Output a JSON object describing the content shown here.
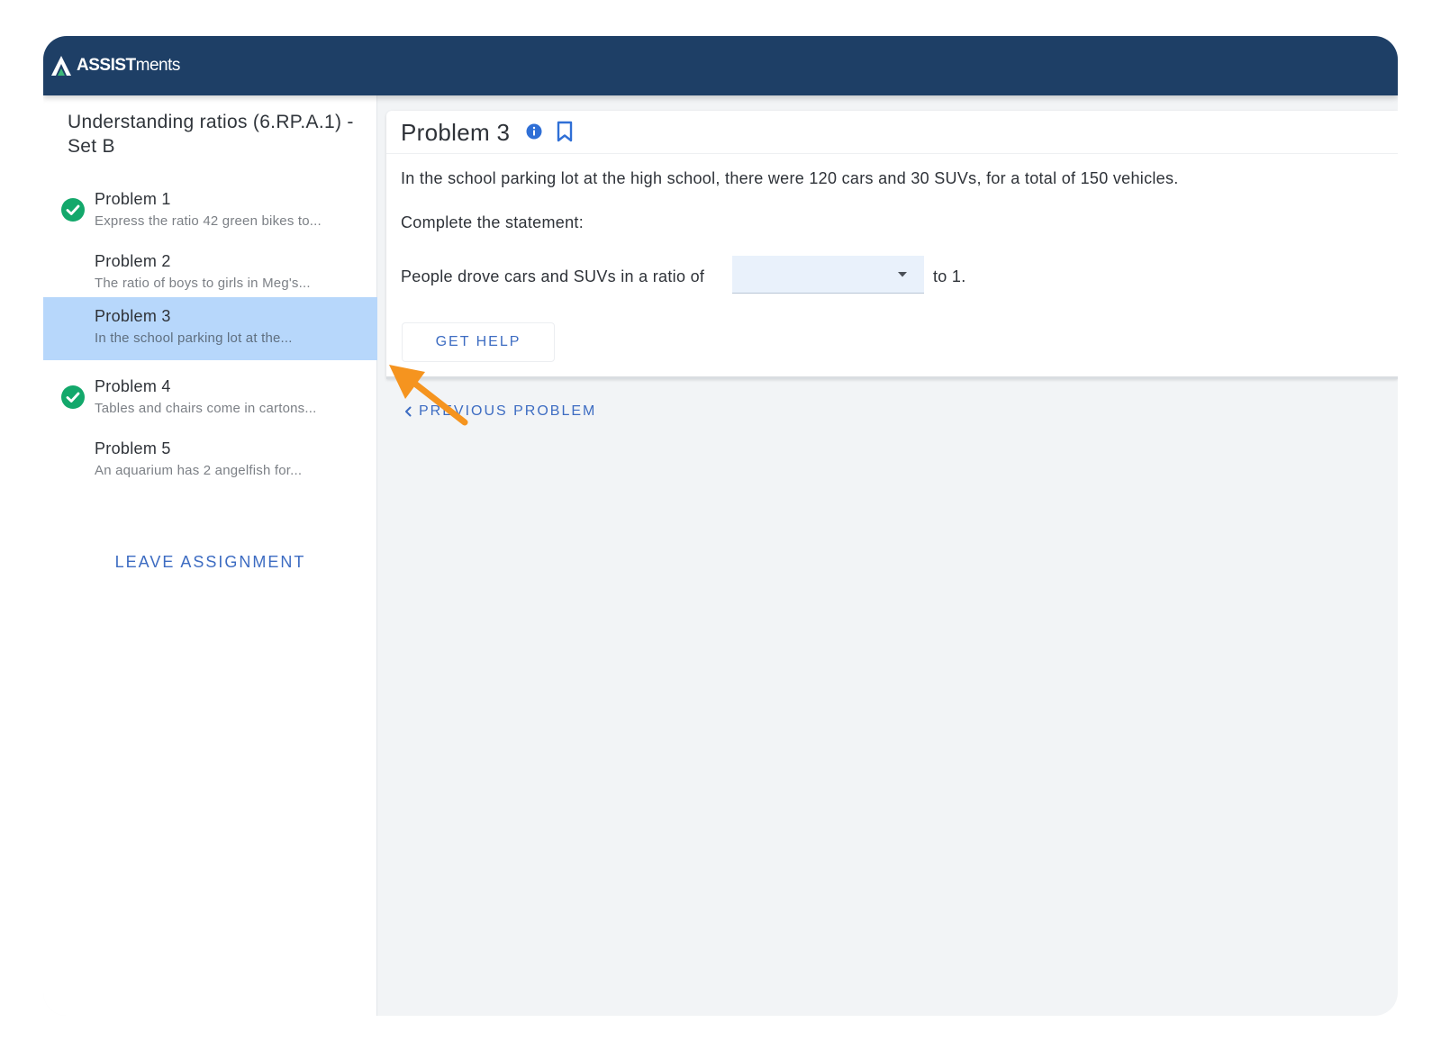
{
  "app": {
    "logo_bold": "ASSIST",
    "logo_light": "ments"
  },
  "sidebar": {
    "assignment_title": "Understanding ratios (6.RP.A.1) - Set B",
    "problems": [
      {
        "name": "Problem 1",
        "preview": "Express the ratio 42 green bikes to...",
        "completed": true,
        "selected": false
      },
      {
        "name": "Problem 2",
        "preview": "The ratio of boys to girls in Meg's...",
        "completed": false,
        "selected": false
      },
      {
        "name": "Problem 3",
        "preview": "In the school parking lot at the...",
        "completed": false,
        "selected": true
      },
      {
        "name": "Problem 4",
        "preview": "Tables and chairs come in cartons...",
        "completed": true,
        "selected": false
      },
      {
        "name": "Problem 5",
        "preview": "An aquarium has 2 angelfish for...",
        "completed": false,
        "selected": false
      }
    ],
    "leave_label": "LEAVE ASSIGNMENT"
  },
  "problem": {
    "title": "Problem 3",
    "text": "In the school parking lot at the high school, there were 120 cars and 30 SUVs, for a total of 150 vehicles.",
    "instruction": "Complete the statement:",
    "statement_before": "People drove cars and SUVs in a ratio of",
    "answer_value": "",
    "statement_after": "to 1.",
    "get_help_label": "GET HELP"
  },
  "nav": {
    "previous_label": "PREVIOUS PROBLEM"
  },
  "colors": {
    "header": "#1e3f66",
    "accent": "#3d6cc2",
    "selected": "#b7d7fb",
    "success": "#13a86b",
    "annotation_arrow": "#f5941f"
  },
  "icons": {
    "logo": "assistments-logo-icon",
    "completed": "check-circle-icon",
    "info": "info-icon",
    "bookmark": "bookmark-icon",
    "dropdown": "caret-down-icon",
    "previous": "chevron-left-icon"
  }
}
